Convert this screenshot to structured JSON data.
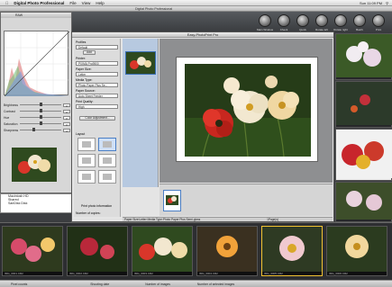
{
  "menubar": {
    "app": "Digital Photo Professional",
    "items": [
      "File",
      "View",
      "Help"
    ],
    "right": [
      "Sun 11:09 PM"
    ]
  },
  "dpp": {
    "title": "Digital Photo Professional",
    "toolbar": [
      "Main Window",
      "Check",
      "Quick",
      "Rotate left",
      "Rotate right",
      "Batch",
      "Print"
    ]
  },
  "tool_palette": {
    "title": "RAW",
    "sliders": [
      {
        "label": "Brightness",
        "value": "0"
      },
      {
        "label": "Contrast",
        "value": "0"
      },
      {
        "label": "Hue",
        "value": "0"
      },
      {
        "label": "Saturation",
        "value": "0"
      },
      {
        "label": "Sharpness",
        "value": "3"
      }
    ]
  },
  "folder_tree": {
    "items": [
      "Macintosh HD",
      "Shared",
      "SanDisk Disk"
    ]
  },
  "epp": {
    "title": "Easy-PhotoPrint Pro",
    "sections": {
      "profiles_label": "Profiles",
      "profiles_value": "Default",
      "add_label": "Add",
      "printer_label": "Printer:",
      "printer_value": "PIXMA Pro9500",
      "paper_size_label": "Paper Size:",
      "paper_size_value": "Letter",
      "media_type_label": "Media Type:",
      "media_type_value": "Photo Paper Plus Se...",
      "paper_source_label": "Paper Source:",
      "paper_source_value": "Auto Sheet Feeder",
      "print_quality_label": "Print Quality:",
      "print_quality_value": "High",
      "color_adjust_label": "Color Adjustment...",
      "layout_label": "Layout",
      "print_info_label": "Print photo information",
      "copies_label": "Number of copies:"
    },
    "toolbar_buttons": [
      "Print",
      "Close"
    ],
    "status_left": "Paper Size:Letter Media Type:Photo Paper Plus Semi-gloss",
    "status_right": "1Page(s)"
  },
  "bottom_thumbs": [
    {
      "caption": "IMG_0001.CR2"
    },
    {
      "caption": "IMG_0002.CR2"
    },
    {
      "caption": "IMG_0003.CR2"
    },
    {
      "caption": "IMG_0004.CR2"
    },
    {
      "caption": "IMG_0005.CR2"
    },
    {
      "caption": "IMG_0006.CR2"
    }
  ],
  "statusbar": {
    "items": [
      "Pixel counts",
      "Shooting date",
      "Number of images",
      "Number of selected images"
    ]
  }
}
